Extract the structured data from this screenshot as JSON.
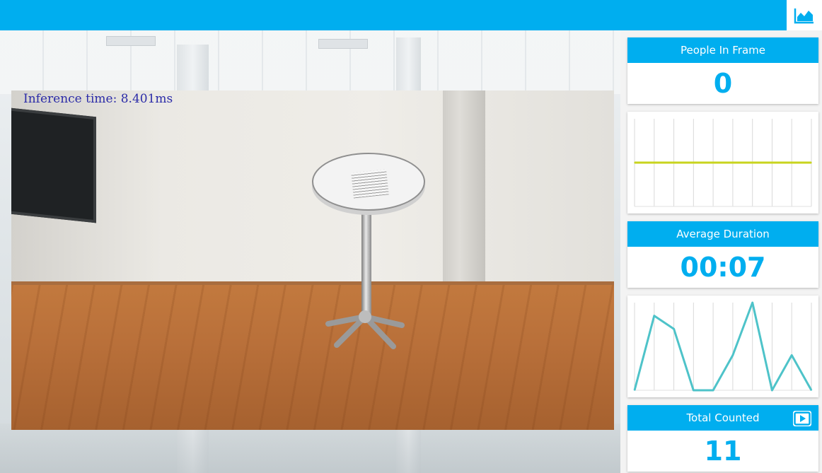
{
  "header": {
    "stats_toggle_icon": "area-chart-icon"
  },
  "video": {
    "inference_label": "Inference time: 8.401ms"
  },
  "stats": {
    "people_in_frame": {
      "label": "People In Frame",
      "value": "0"
    },
    "average_duration": {
      "label": "Average Duration",
      "value": "00:07"
    },
    "total_counted": {
      "label": "Total Counted",
      "value": "11",
      "action_icon": "play-icon"
    }
  },
  "colors": {
    "accent": "#00aeef",
    "people_chart_line": "#c8d41e",
    "duration_chart_line": "#4ec3c9"
  },
  "chart_data": [
    {
      "type": "line",
      "series": [
        {
          "values": [
            0,
            0,
            0,
            0,
            0,
            0,
            0,
            0,
            0,
            0
          ]
        }
      ],
      "ylim": [
        -1,
        1
      ],
      "grid": true
    },
    {
      "type": "line",
      "series": [
        {
          "values": [
            0,
            8.5,
            7,
            0,
            0,
            4,
            10,
            0,
            4,
            0
          ]
        }
      ],
      "ylim": [
        0,
        10
      ],
      "grid": true
    }
  ]
}
